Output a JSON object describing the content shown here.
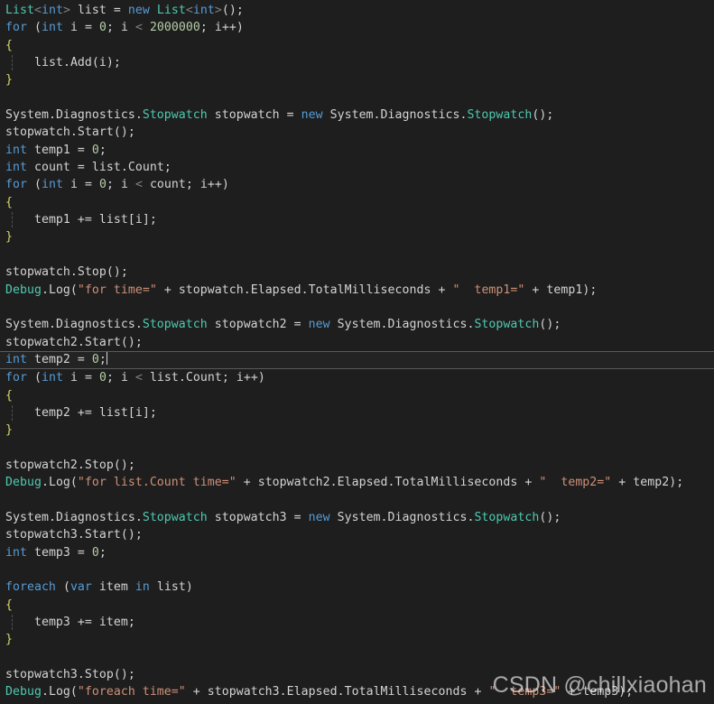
{
  "editor": {
    "language": "csharp",
    "theme": "dark",
    "background_color": "#1e1e1e",
    "foreground_color": "#d4d4d4",
    "current_line_number": 21,
    "colors": {
      "keyword": "#569cd6",
      "type": "#4ec9b0",
      "string": "#ce9178",
      "number": "#b5cea8",
      "plain": "#d4d4d4",
      "brace": "#d7d76b",
      "angle_bracket": "#808080",
      "current_line_background": "#232323",
      "current_line_border": "#5a5a5a",
      "indent_guide": "#505050"
    },
    "lines": [
      {
        "n": 1,
        "indent": 0,
        "text": "List<int> list = new List<int>();"
      },
      {
        "n": 2,
        "indent": 0,
        "text": "for (int i = 0; i < 2000000; i++)"
      },
      {
        "n": 3,
        "indent": 0,
        "text": "{"
      },
      {
        "n": 4,
        "indent": 1,
        "text": "    list.Add(i);"
      },
      {
        "n": 5,
        "indent": 0,
        "text": "}"
      },
      {
        "n": 6,
        "indent": 0,
        "text": ""
      },
      {
        "n": 7,
        "indent": 0,
        "text": "System.Diagnostics.Stopwatch stopwatch = new System.Diagnostics.Stopwatch();"
      },
      {
        "n": 8,
        "indent": 0,
        "text": "stopwatch.Start();"
      },
      {
        "n": 9,
        "indent": 0,
        "text": "int temp1 = 0;"
      },
      {
        "n": 10,
        "indent": 0,
        "text": "int count = list.Count;"
      },
      {
        "n": 11,
        "indent": 0,
        "text": "for (int i = 0; i < count; i++)"
      },
      {
        "n": 12,
        "indent": 0,
        "text": "{"
      },
      {
        "n": 13,
        "indent": 1,
        "text": "    temp1 += list[i];"
      },
      {
        "n": 14,
        "indent": 0,
        "text": "}"
      },
      {
        "n": 15,
        "indent": 0,
        "text": ""
      },
      {
        "n": 16,
        "indent": 0,
        "text": "stopwatch.Stop();"
      },
      {
        "n": 17,
        "indent": 0,
        "text": "Debug.Log(\"for time=\" + stopwatch.Elapsed.TotalMilliseconds + \"  temp1=\" + temp1);"
      },
      {
        "n": 18,
        "indent": 0,
        "text": ""
      },
      {
        "n": 19,
        "indent": 0,
        "text": "System.Diagnostics.Stopwatch stopwatch2 = new System.Diagnostics.Stopwatch();"
      },
      {
        "n": 20,
        "indent": 0,
        "text": "stopwatch2.Start();"
      },
      {
        "n": 21,
        "indent": 0,
        "text": "int temp2 = 0;"
      },
      {
        "n": 22,
        "indent": 0,
        "text": "for (int i = 0; i < list.Count; i++)"
      },
      {
        "n": 23,
        "indent": 0,
        "text": "{"
      },
      {
        "n": 24,
        "indent": 1,
        "text": "    temp2 += list[i];"
      },
      {
        "n": 25,
        "indent": 0,
        "text": "}"
      },
      {
        "n": 26,
        "indent": 0,
        "text": ""
      },
      {
        "n": 27,
        "indent": 0,
        "text": "stopwatch2.Stop();"
      },
      {
        "n": 28,
        "indent": 0,
        "text": "Debug.Log(\"for list.Count time=\" + stopwatch2.Elapsed.TotalMilliseconds + \"  temp2=\" + temp2);"
      },
      {
        "n": 29,
        "indent": 0,
        "text": ""
      },
      {
        "n": 30,
        "indent": 0,
        "text": "System.Diagnostics.Stopwatch stopwatch3 = new System.Diagnostics.Stopwatch();"
      },
      {
        "n": 31,
        "indent": 0,
        "text": "stopwatch3.Start();"
      },
      {
        "n": 32,
        "indent": 0,
        "text": "int temp3 = 0;"
      },
      {
        "n": 33,
        "indent": 0,
        "text": ""
      },
      {
        "n": 34,
        "indent": 0,
        "text": "foreach (var item in list)"
      },
      {
        "n": 35,
        "indent": 0,
        "text": "{"
      },
      {
        "n": 36,
        "indent": 1,
        "text": "    temp3 += item;"
      },
      {
        "n": 37,
        "indent": 0,
        "text": "}"
      },
      {
        "n": 38,
        "indent": 0,
        "text": ""
      },
      {
        "n": 39,
        "indent": 0,
        "text": "stopwatch3.Stop();"
      },
      {
        "n": 40,
        "indent": 0,
        "text": "Debug.Log(\"foreach time=\" + stopwatch3.Elapsed.TotalMilliseconds + \"  temp3=\" + temp3);"
      }
    ]
  },
  "watermark": {
    "text": "CSDN @chillxiaohan"
  }
}
